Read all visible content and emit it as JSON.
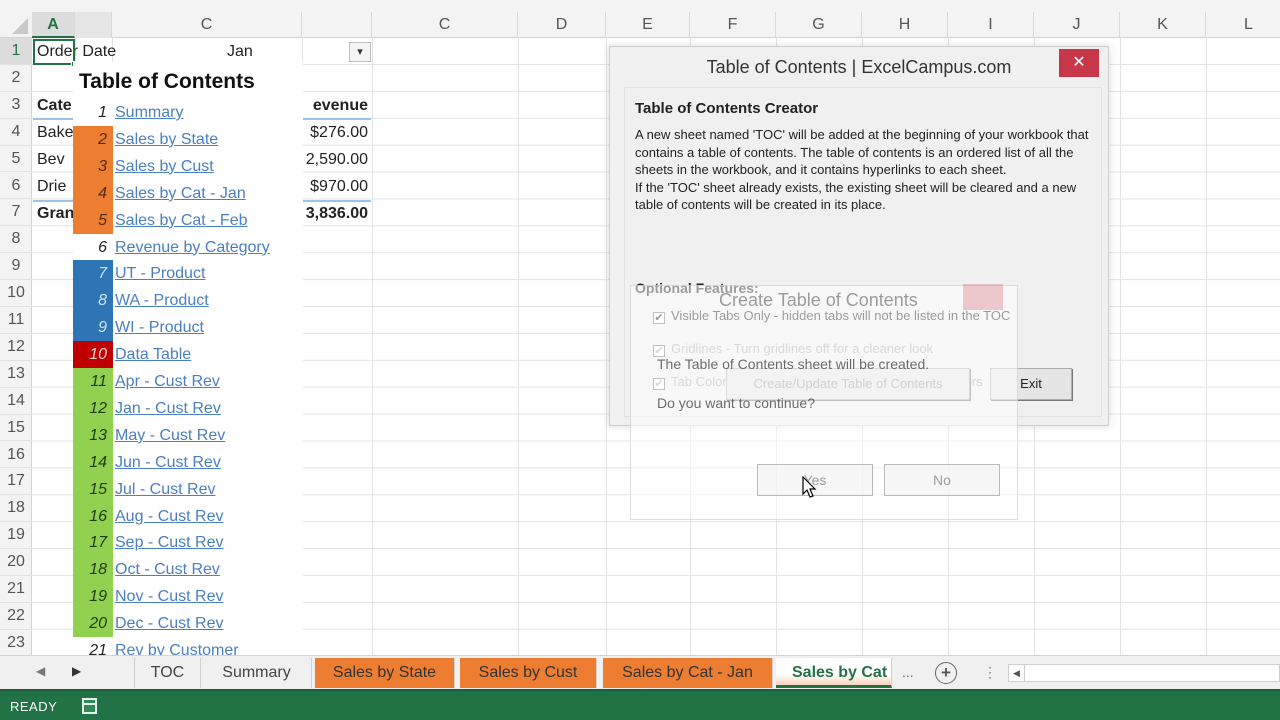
{
  "spreadsheet": {
    "column_headers": [
      "A",
      "",
      "C",
      "",
      "C",
      "D",
      "E",
      "F",
      "G",
      "H",
      "I",
      "J",
      "K",
      "L"
    ],
    "active_column": "A",
    "row_numbers": [
      "1",
      "2",
      "3",
      "4",
      "5",
      "6",
      "7",
      "8",
      "9",
      "10",
      "11",
      "12",
      "13",
      "14",
      "15",
      "16",
      "17",
      "18",
      "19",
      "20",
      "21",
      "22",
      "23"
    ],
    "active_row": "1",
    "cells": {
      "a1": "Order Date",
      "c1": "Jan",
      "filter_icon": "▾",
      "a3": "Cate",
      "a4": "Bake",
      "a5": "Bev",
      "a6": "Drie",
      "a7": "Gran",
      "d3": "evenue",
      "d4": "$276.00",
      "d5": "2,590.00",
      "d6": "$970.00",
      "d7": "3,836.00"
    }
  },
  "toc": {
    "title": "Table of Contents",
    "items": [
      {
        "num": "1",
        "label": "Summary",
        "color": ""
      },
      {
        "num": "2",
        "label": "Sales by State",
        "color": "#ED7D31"
      },
      {
        "num": "3",
        "label": "Sales by Cust",
        "color": "#ED7D31"
      },
      {
        "num": "4",
        "label": "Sales by Cat - Jan",
        "color": "#ED7D31"
      },
      {
        "num": "5",
        "label": "Sales by Cat - Feb",
        "color": "#ED7D31"
      },
      {
        "num": "6",
        "label": "Revenue by Category",
        "color": ""
      },
      {
        "num": "7",
        "label": "UT - Product",
        "color": "#2E75B6"
      },
      {
        "num": "8",
        "label": "WA - Product",
        "color": "#2E75B6"
      },
      {
        "num": "9",
        "label": "WI - Product",
        "color": "#2E75B6"
      },
      {
        "num": "10",
        "label": "Data Table",
        "color": "#C00000"
      },
      {
        "num": "11",
        "label": "Apr - Cust Rev",
        "color": "#92D050"
      },
      {
        "num": "12",
        "label": "Jan - Cust Rev",
        "color": "#92D050"
      },
      {
        "num": "13",
        "label": "May - Cust Rev",
        "color": "#92D050"
      },
      {
        "num": "14",
        "label": "Jun - Cust Rev",
        "color": "#92D050"
      },
      {
        "num": "15",
        "label": "Jul - Cust Rev",
        "color": "#92D050"
      },
      {
        "num": "16",
        "label": "Aug - Cust Rev",
        "color": "#92D050"
      },
      {
        "num": "17",
        "label": "Sep - Cust Rev",
        "color": "#92D050"
      },
      {
        "num": "18",
        "label": "Oct - Cust Rev",
        "color": "#92D050"
      },
      {
        "num": "19",
        "label": "Nov - Cust Rev",
        "color": "#92D050"
      },
      {
        "num": "20",
        "label": "Dec - Cust Rev",
        "color": "#92D050"
      },
      {
        "num": "21",
        "label": "Rev by Customer",
        "color": ""
      }
    ]
  },
  "dialog": {
    "title": "Table of Contents | ExcelCampus.com",
    "close_icon": "✕",
    "heading": "Table of Contents Creator",
    "description_1": "A new sheet named 'TOC' will be added at the beginning of your workbook that contains a table of contents.  The table of contents is an ordered list of all the sheets in the workbook, and it contains hyperlinks to each sheet.",
    "description_2": "If the 'TOC' sheet already exists, the existing sheet will be cleared and a new table of contents will be created in its place.",
    "optional_heading": "Optional Features:",
    "options": [
      {
        "label": "Visible Tabs Only - hidden tabs will not be listed in the TOC",
        "checked": true
      },
      {
        "label": "Gridlines - Turn gridlines off for a cleaner look",
        "checked": true
      },
      {
        "label": "Tab Colors - fill the cells in the TOC with the tab colors",
        "checked": true
      }
    ],
    "create_button": "Create/Update Table of Contents",
    "exit_button": "Exit"
  },
  "confirm_dialog": {
    "title": "Create Table of Contents",
    "message": "The Table of Contents sheet will be created.",
    "question": "Do you want to continue?",
    "yes_button": "Yes",
    "no_button": "No"
  },
  "sheet_tabs": {
    "nav_prev": "◀",
    "nav_next": "▶",
    "tabs": [
      {
        "label": "TOC",
        "color": "",
        "active": false
      },
      {
        "label": "Summary",
        "color": "",
        "active": false
      },
      {
        "label": "Sales by State",
        "color": "#ED7D31",
        "active": false
      },
      {
        "label": "Sales by Cust",
        "color": "#ED7D31",
        "active": false
      },
      {
        "label": "Sales by Cat - Jan",
        "color": "#ED7D31",
        "active": false
      },
      {
        "label": "Sales by Cat - Feb",
        "color": "#ED7D31",
        "active": true
      }
    ],
    "more": "...",
    "add_sheet": "+",
    "split": "⋮",
    "scroll_left": "◀"
  },
  "status_bar": {
    "mode": "READY"
  },
  "colors": {
    "excel_green": "#217346",
    "dialog_close": "#C8364A",
    "link": "#4A7FC1"
  }
}
